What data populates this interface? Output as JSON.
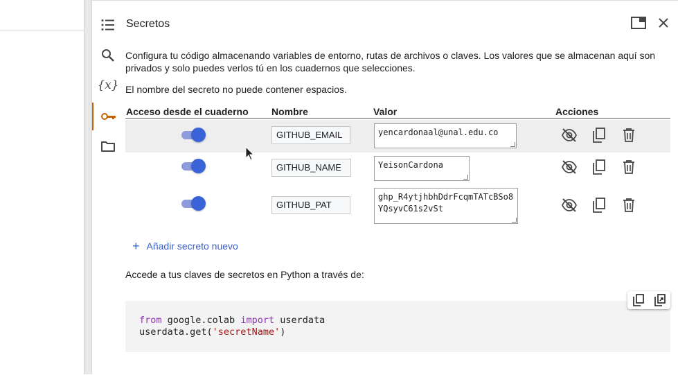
{
  "panel": {
    "title": "Secretos",
    "description": "Configura tu código almacenando variables de entorno, rutas de archivos o claves. Los valores que se almacenan aquí son privados y solo puedes verlos tú en los cuadernos que selecciones.",
    "note": "El nombre del secreto no puede contener espacios."
  },
  "rail": {
    "icons": [
      "toc-icon",
      "search-icon",
      "variables-icon",
      "key-icon",
      "folder-icon"
    ],
    "active": "key-icon",
    "accent": "#c26401"
  },
  "table": {
    "headers": {
      "access": "Acceso desde el cuaderno",
      "name": "Nombre",
      "value": "Valor",
      "actions": "Acciones"
    },
    "rows": [
      {
        "enabled": true,
        "name": "GITHUB_EMAIL",
        "value": "yencardonaal@unal.edu.co"
      },
      {
        "enabled": true,
        "name": "GITHUB_NAME",
        "value": "YeisonCardona"
      },
      {
        "enabled": true,
        "name": "GITHUB_PAT",
        "value": "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"
      }
    ]
  },
  "add_label": "Añadir secreto nuevo",
  "access_note": "Accede a tus claves de secretos en Python a través de:",
  "code": {
    "kw_from": "from",
    "module": " google.colab ",
    "kw_import": "import",
    "name": " userdata",
    "call_prefix": "userdata.get(",
    "arg": "'secretName'",
    "call_suffix": ")"
  },
  "colors": {
    "toggle_on": "#3b63d8",
    "link": "#3a5fc8",
    "keyword": "#8e35b8",
    "string": "#a31515"
  }
}
